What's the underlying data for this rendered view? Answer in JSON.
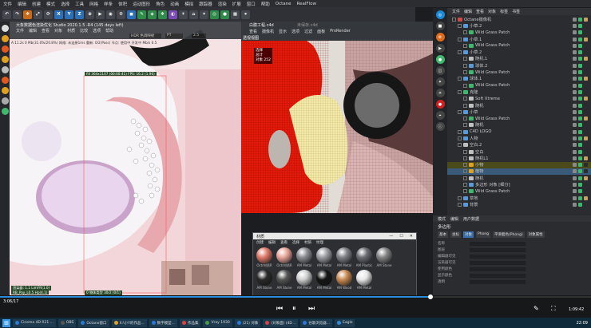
{
  "menu": [
    "文件",
    "编辑",
    "创建",
    "模式",
    "选择",
    "工具",
    "网格",
    "样条",
    "体积",
    "运动图形",
    "角色",
    "动画",
    "模拟",
    "跟踪器",
    "渲染",
    "扩展",
    "窗口",
    "帮助",
    "Octane",
    "RealFlow"
  ],
  "toolbar": {
    "axes": [
      "X",
      "Y",
      "Z"
    ]
  },
  "render_view": {
    "title": "大象数据色渲染优化 Studio 2020.1.5 -R4 (145 days left)",
    "menu": [
      "文件",
      "编辑",
      "查看",
      "对象",
      "材质",
      "比较",
      "选项",
      "帮助"
    ],
    "mode": "HDR 色调映射",
    "pt": "PT",
    "zoom": "2.5",
    "status_line": "A:11.2s 0 Mb(31.0%/20.8%) 网络: 未连接1ms 重新: 0/2(Pass) 节点: 使用中 开发中 Mb/s 0.5",
    "sel_label": "fill 364x1107 (00:00:41) FPS: 16.2 (1.90)",
    "info_lines": [
      "渲染器: 1.1 LimFR(1.0)",
      "RB_Pay_L0.5 Hp(4.1)"
    ],
    "bottom_label": "0 物体类型 30/2 (0/1)"
  },
  "viewport": {
    "tabs": [
      "白膜工程.c4d",
      "未保存.c4d"
    ],
    "menu": [
      "查看",
      "摄像机",
      "显示",
      "选项",
      "过滤",
      "面板",
      "ProRender"
    ],
    "camera": "透视视图",
    "overlay": [
      "选择",
      "总计",
      "对象 252"
    ]
  },
  "object_manager": {
    "menu": [
      "文件",
      "编辑",
      "查看",
      "对象",
      "标签",
      "书签"
    ],
    "items": [
      {
        "name": "Octane摄像机",
        "indent": 0,
        "color": "#d14a4a"
      },
      {
        "name": "小草.2",
        "indent": 1,
        "color": "#5a9ad8"
      },
      {
        "name": "Wild Grass Patch",
        "indent": 2,
        "color": "#3fb86e"
      },
      {
        "name": "小草.1",
        "indent": 1,
        "color": "#5a9ad8"
      },
      {
        "name": "Wild Grass Patch",
        "indent": 2,
        "color": "#3fb86e"
      },
      {
        "name": "小草.2",
        "indent": 1,
        "color": "#5a9ad8"
      },
      {
        "name": "随机.1",
        "indent": 2,
        "color": "#c0c0c0"
      },
      {
        "name": "球体.2",
        "indent": 2,
        "color": "#5a9ad8"
      },
      {
        "name": "Wild Grass Patch",
        "indent": 2,
        "color": "#3fb86e"
      },
      {
        "name": "球体.1",
        "indent": 1,
        "color": "#5a9ad8"
      },
      {
        "name": "Wild Grass Patch",
        "indent": 2,
        "color": "#3fb86e"
      },
      {
        "name": "克隆",
        "indent": 1,
        "color": "#3fb86e"
      },
      {
        "name": "Soft Xtreme",
        "indent": 2,
        "color": "#c0c0c0"
      },
      {
        "name": "随机",
        "indent": 2,
        "color": "#c0c0c0"
      },
      {
        "name": "小草",
        "indent": 1,
        "color": "#5a9ad8"
      },
      {
        "name": "Wild Grass Patch",
        "indent": 2,
        "color": "#3fb86e"
      },
      {
        "name": "随机",
        "indent": 2,
        "color": "#c0c0c0"
      },
      {
        "name": "C4D LOGO",
        "indent": 1,
        "color": "#5a9ad8"
      },
      {
        "name": "人物",
        "indent": 1,
        "color": "#5a9ad8"
      },
      {
        "name": "空白.2",
        "indent": 1,
        "color": "#c0c0c0"
      },
      {
        "name": "空白",
        "indent": 2,
        "color": "#c0c0c0"
      },
      {
        "name": "随机L1",
        "indent": 2,
        "color": "#c0c0c0"
      },
      {
        "name": "小物",
        "indent": 2,
        "color": "#e0a020"
      },
      {
        "name": "植物",
        "indent": 2,
        "color": "#e0a020"
      },
      {
        "name": "随机",
        "indent": 2,
        "color": "#c0c0c0"
      },
      {
        "name": "多边形 对象 [细分]",
        "indent": 2,
        "color": "#5a9ad8"
      },
      {
        "name": "Wild Grass Patch",
        "indent": 2,
        "color": "#3fb86e"
      },
      {
        "name": "草地",
        "indent": 1,
        "color": "#5a9ad8"
      },
      {
        "name": "背景",
        "indent": 1,
        "color": "#5a9ad8"
      }
    ]
  },
  "attributes": {
    "menu": [
      "模式",
      "编辑",
      "用户数据"
    ],
    "title": "多边形",
    "tabs": [
      "基本",
      "坐标",
      "对象",
      "Phong",
      "平滑着色(Phong)",
      "对象属性"
    ],
    "rows": [
      "名称",
      "图层",
      "编辑器可见",
      "渲染器可见",
      "使用颜色",
      "显示颜色",
      "透明"
    ]
  },
  "material_window": {
    "title": "材质",
    "menu": [
      "创建",
      "编辑",
      "查看",
      "选择",
      "材质",
      "纹理"
    ],
    "materials": [
      {
        "name": "Octr材质R",
        "color": "#e07a6a"
      },
      {
        "name": "Octr材质R",
        "color": "#e8a69a"
      },
      {
        "name": "AM Metal",
        "color": "#8a8d92"
      },
      {
        "name": "AM Metal",
        "color": "#9a9da2"
      },
      {
        "name": "AM Metal",
        "color": "#7d8085"
      },
      {
        "name": "AM Plastic",
        "color": "#6a6d72"
      },
      {
        "name": "AM Stone",
        "color": "#858585"
      },
      {
        "name": "AM Stone",
        "color": "#2a2a2a"
      },
      {
        "name": "AM Stone",
        "color": "#555555"
      },
      {
        "name": "AM Metal",
        "color": "#cfcfcf"
      },
      {
        "name": "AM Metal",
        "color": "#151515"
      },
      {
        "name": "AM Wood",
        "color": "#c98a52"
      },
      {
        "name": "AM Metal",
        "color": "#e8e8e8"
      }
    ]
  },
  "timeline": {
    "frame_label": "3:06/17",
    "time_label": "1:09:42"
  },
  "taskbar": {
    "items": [
      {
        "label": "Cinema 4D R21 ...",
        "color": "#2a7ad8"
      },
      {
        "label": "OBS",
        "color": "#555"
      },
      {
        "label": "Octane窗口",
        "color": "#2a7ad8"
      },
      {
        "label": "X:\\小Y的作品...",
        "color": "#e0a020"
      },
      {
        "label": "数字模型...",
        "color": "#2a7ad8"
      },
      {
        "label": "作品集",
        "color": "#e04040"
      },
      {
        "label": "Vray 1930",
        "color": "#4a9a4a"
      },
      {
        "label": "(21) 对象",
        "color": "#2a7ad8"
      },
      {
        "label": "(对象面) (4D ..",
        "color": "#e04040"
      },
      {
        "label": "谷歌浏览器...",
        "color": "#2a7ad8"
      },
      {
        "label": "Eagle",
        "color": "#3a8ad8"
      }
    ],
    "clock": "22:09"
  }
}
